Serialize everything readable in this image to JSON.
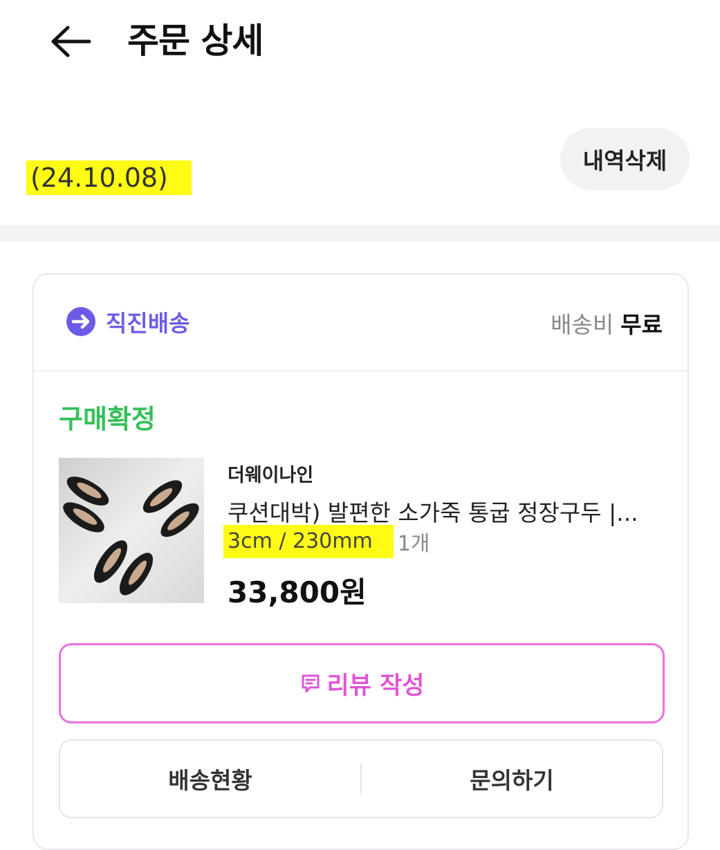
{
  "header": {
    "title": "주문 상세",
    "back_icon": "arrow-left-icon"
  },
  "order": {
    "date": "(24.10.08)",
    "delete_label": "내역삭제"
  },
  "shipping": {
    "type_label": "직진배송",
    "type_icon": "arrow-circle-icon",
    "fee_label": "배송비",
    "fee_value": "무료"
  },
  "item": {
    "status": "구매확정",
    "brand": "더웨이나인",
    "name": "쿠션대박) 발편한 소가죽 통굽 정장구두 |...",
    "option": "3cm / 230mm",
    "quantity": "1개",
    "price": "33,800원"
  },
  "actions": {
    "review_label": "리뷰 작성",
    "review_icon": "message-icon",
    "tracking_label": "배송현황",
    "inquiry_label": "문의하기"
  },
  "colors": {
    "accent": "#6b5ce7",
    "status": "#34c05a",
    "review": "#e055d6",
    "highlight": "#fffb14"
  }
}
